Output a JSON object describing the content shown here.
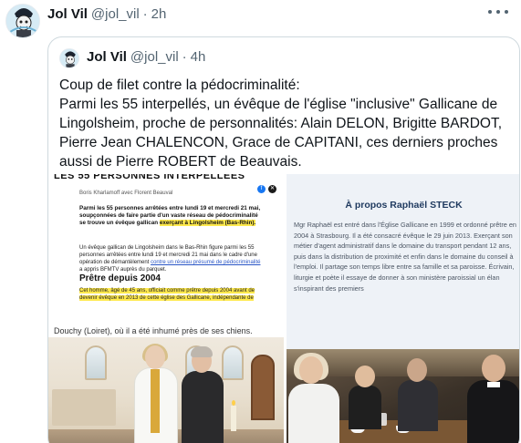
{
  "tweet": {
    "display_name": "Jol Vil",
    "handle": "@jol_vil",
    "separator": "·",
    "time": "2h",
    "more_icon": "more-horizontal-icon"
  },
  "quoted": {
    "display_name": "Jol Vil",
    "handle": "@jol_vil",
    "separator": "·",
    "time": "4h",
    "text": "Coup de filet contre la pédocriminalité:\nParmi les 55 interpellés, un évêque de l'église \"inclusive\" Gallicane de Lingolsheim, proche de personnalités: Alain DELON, Brigitte BARDOT, Pierre Jean CHALENCON, Grace de CAPITANI, ces derniers proches aussi de Pierre ROBERT de Beauvais."
  },
  "media": {
    "article": {
      "heading": "LES 55 PERSONNES INTERPELLÉES",
      "byline": "Boris Kharlamoff avec Florent Beauval",
      "lead_1": "Parmi les 55 personnes arrêtées entre lundi 19 et mercredi 21 mai, soupçonnées de faire partie d'un vaste réseau de pédocriminalité se trouve un évêque gallican ",
      "lead_hl": "exerçant à Lingolsheim (Bas-Rhin).",
      "body1_a": "Un évêque gallican de Lingolsheim dans le Bas-Rhin figure parmi les 55 personnes arrêtées entre lundi 19 et mercredi 21 mai dans le cadre d'une opération de démantèlement ",
      "body1_link": "contre un réseau présumé de pédocriminalité",
      "body1_b": " a appris BFMTV auprès du parquet.",
      "subheading": "Prêtre depuis 2004",
      "body2": "Cet homme, âgé de 45 ans, officiait comme prêtre depuis 2004 avant de devenir évêque en 2013 de cette église des Gallicane, indépendante de"
    },
    "caption": "Douchy (Loiret), où il a été inhumé près de ses chiens.",
    "apropos": {
      "title": "À propos Raphaël STECK",
      "text": "Mgr Raphaël est entré dans l'Église Gallicane en 1999 et ordonné prêtre en 2004 à Strasbourg. Il a été consacré évêque le 29 juin 2013. Exerçant son métier d'agent administratif dans le domaine du transport pendant 12 ans, puis dans la distribution de proximité et enfin dans le domaine du conseil à l'emploi. Il partage son temps libre entre sa famille et sa paroisse. Écrivain, liturgie et poète il essaye de donner à son ministère paroissial un élan s'inspirant des premiers"
    }
  }
}
